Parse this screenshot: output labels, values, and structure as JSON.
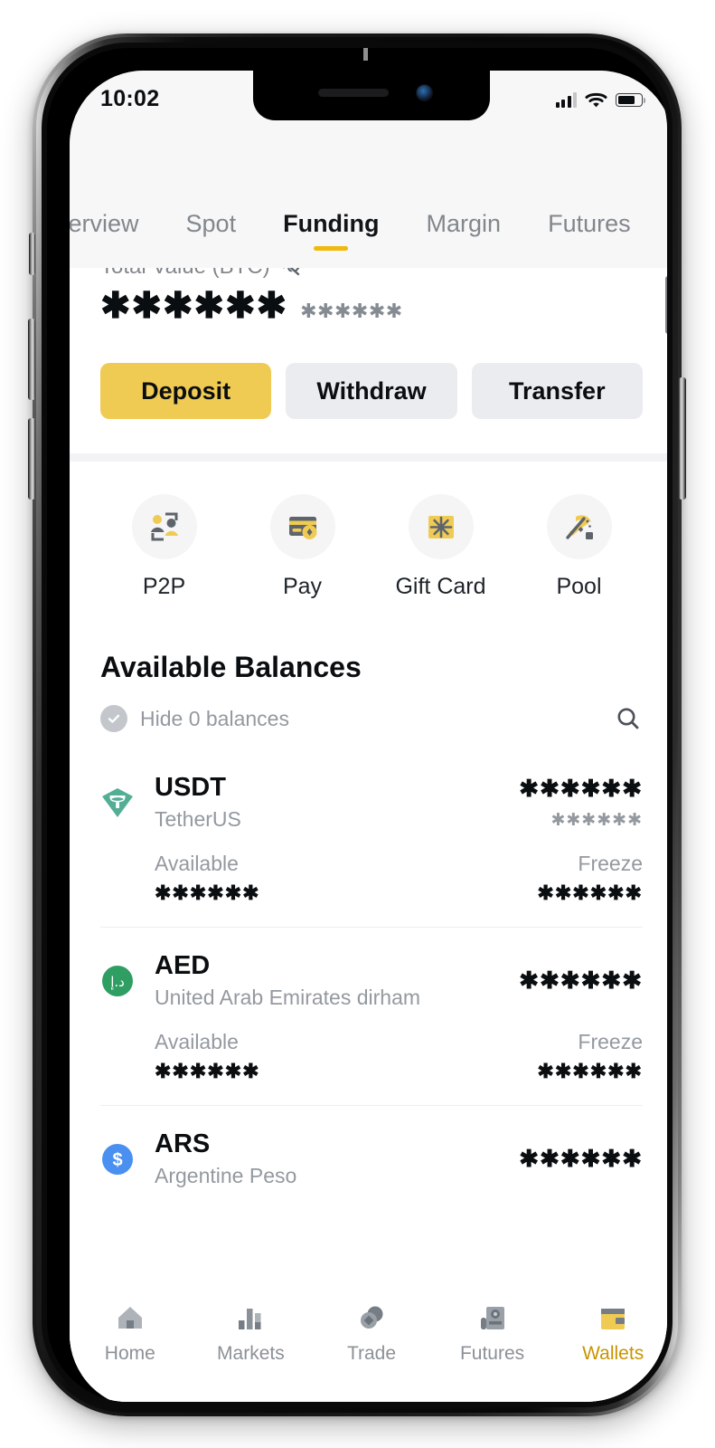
{
  "status_bar": {
    "time": "10:02",
    "signal_icon": "signal-bars-icon",
    "wifi_icon": "wifi-icon",
    "battery_icon": "battery-icon"
  },
  "tabs": [
    {
      "label": "Overview",
      "active": false
    },
    {
      "label": "Spot",
      "active": false
    },
    {
      "label": "Funding",
      "active": true
    },
    {
      "label": "Margin",
      "active": false
    },
    {
      "label": "Futures",
      "active": false
    }
  ],
  "balance": {
    "total_label": "Total Value (BTC)",
    "hide_icon": "eye-off-icon",
    "total_value": "✱✱✱✱✱✱",
    "total_value_sub": "✱✱✱✱✱✱",
    "buttons": [
      {
        "label": "Deposit",
        "style": "primary"
      },
      {
        "label": "Withdraw",
        "style": "secondary"
      },
      {
        "label": "Transfer",
        "style": "secondary"
      }
    ]
  },
  "quick_actions": [
    {
      "label": "P2P",
      "icon": "p2p-icon"
    },
    {
      "label": "Pay",
      "icon": "pay-card-icon"
    },
    {
      "label": "Gift Card",
      "icon": "gift-card-icon"
    },
    {
      "label": "Pool",
      "icon": "pickaxe-mining-icon"
    }
  ],
  "balances_section": {
    "title": "Available Balances",
    "hide_checkbox_label": "Hide 0 balances",
    "hide_checked": true,
    "search_icon": "search-icon"
  },
  "coins": [
    {
      "symbol": "USDT",
      "name": "TetherUS",
      "icon": "tether-icon",
      "icon_color": "#4fae94",
      "amount": "✱✱✱✱✱✱",
      "amount_sub": "✱✱✱✱✱✱",
      "available_label": "Available",
      "available_value": "✱✱✱✱✱✱",
      "freeze_label": "Freeze",
      "freeze_value": "✱✱✱✱✱✱"
    },
    {
      "symbol": "AED",
      "name": "United Arab Emirates dirham",
      "icon": "aed-currency-icon",
      "icon_color": "#2f9e63",
      "icon_glyph": "د.إ",
      "amount": "✱✱✱✱✱✱",
      "amount_sub": "",
      "available_label": "Available",
      "available_value": "✱✱✱✱✱✱",
      "freeze_label": "Freeze",
      "freeze_value": "✱✱✱✱✱✱"
    },
    {
      "symbol": "ARS",
      "name": "Argentine Peso",
      "icon": "ars-currency-icon",
      "icon_color": "#4a90f0",
      "icon_glyph": "$",
      "amount": "✱✱✱✱✱✱",
      "amount_sub": "",
      "available_label": "Available",
      "available_value": "✱✱✱✱✱✱",
      "freeze_label": "Freeze",
      "freeze_value": "✱✱✱✱✱✱"
    }
  ],
  "bottom_nav": [
    {
      "label": "Home",
      "icon": "home-icon",
      "active": false
    },
    {
      "label": "Markets",
      "icon": "markets-bars-icon",
      "active": false
    },
    {
      "label": "Trade",
      "icon": "trade-icon",
      "active": false
    },
    {
      "label": "Futures",
      "icon": "futures-icon",
      "active": false
    },
    {
      "label": "Wallets",
      "icon": "wallet-icon",
      "active": true
    }
  ],
  "colors": {
    "accent": "#f0b90b",
    "primary_button": "#f0cb53",
    "active_nav": "#c99400",
    "text_primary": "#0b0e11",
    "text_muted": "#9499a0"
  }
}
